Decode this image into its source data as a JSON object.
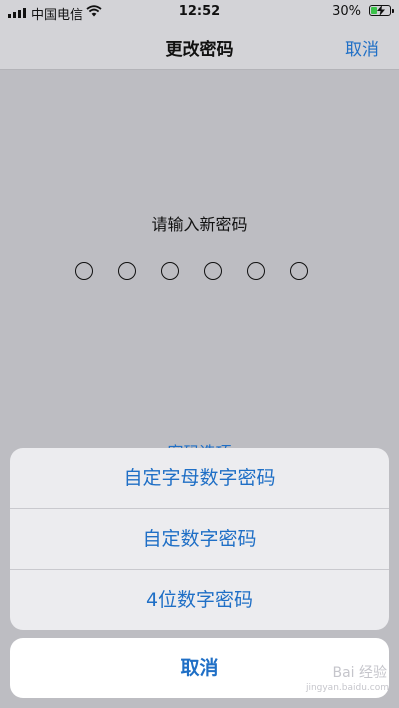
{
  "status_bar": {
    "carrier": "中国电信",
    "time": "12:52",
    "battery_percent": "30%",
    "battery_level": 0.3,
    "battery_color": "#3bc14a"
  },
  "nav": {
    "title": "更改密码",
    "cancel_label": "取消"
  },
  "passcode": {
    "prompt": "请输入新密码",
    "digit_count": 6,
    "options_link": "密码选项"
  },
  "action_sheet": {
    "items": [
      {
        "label": "自定字母数字密码"
      },
      {
        "label": "自定数字密码"
      },
      {
        "label": "4位数字密码"
      }
    ],
    "cancel_label": "取消"
  },
  "watermark": {
    "text": "Bai 经验",
    "sub": "jingyan.baidu.com"
  },
  "colors": {
    "accent": "#1f6fc6"
  }
}
